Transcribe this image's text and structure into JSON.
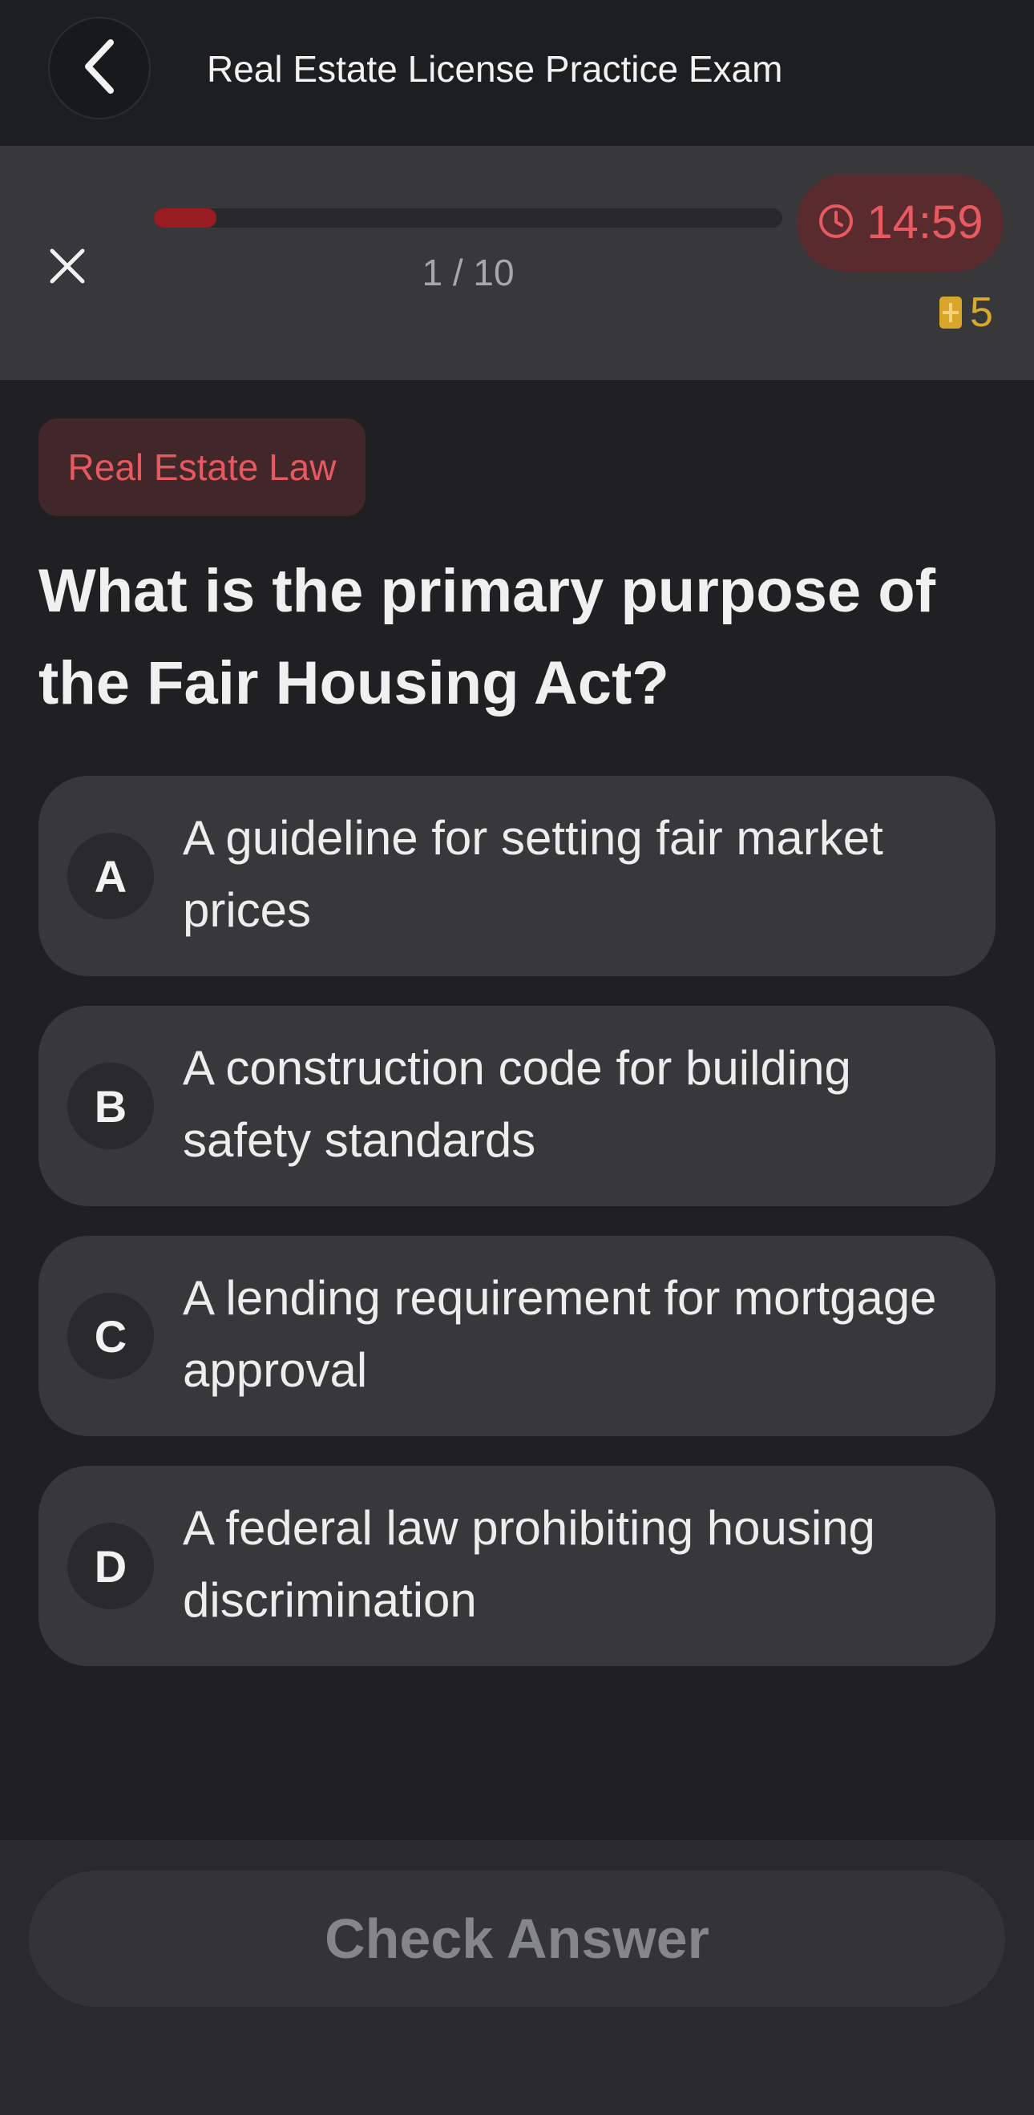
{
  "nav": {
    "title": "Real Estate License Practice Exam",
    "back_icon": "chevron-left-icon"
  },
  "progress": {
    "close_icon": "close-icon",
    "fraction": 0.1,
    "count_text": "1 / 10",
    "timer": "14:59",
    "timer_icon": "clock-icon",
    "coins": "5",
    "coin_icon": "coin-icon"
  },
  "question": {
    "category": "Real Estate Law",
    "text": "What is the primary purpose of the Fair Housing Act?"
  },
  "options": [
    {
      "letter": "A",
      "text": "A guideline for setting fair market prices"
    },
    {
      "letter": "B",
      "text": "A construction code for building safety standards"
    },
    {
      "letter": "C",
      "text": "A lending requirement for mortgage approval"
    },
    {
      "letter": "D",
      "text": "A federal law prohibiting housing discrimination"
    }
  ],
  "footer": {
    "check_label": "Check Answer"
  },
  "colors": {
    "accent_red": "#e55960",
    "progress_fill": "#9b1c22",
    "coin": "#d9a92c",
    "background": "#202022"
  }
}
